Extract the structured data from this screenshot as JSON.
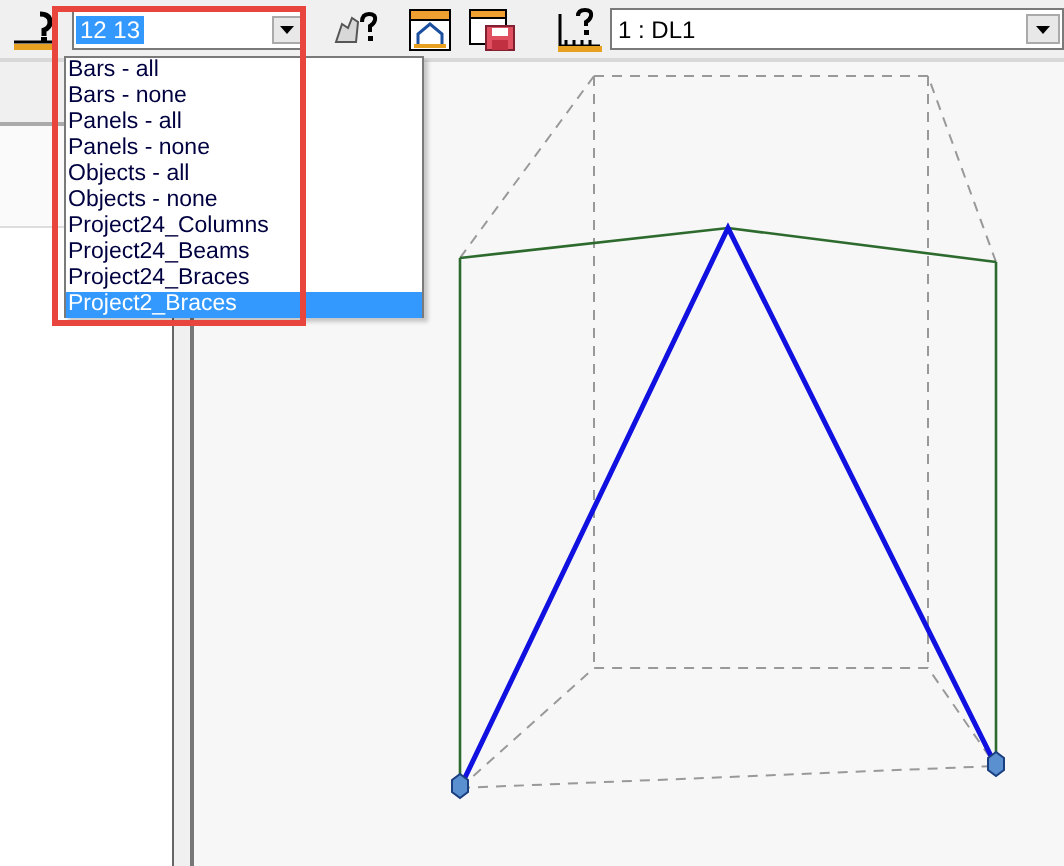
{
  "toolbar": {
    "selection_combo": {
      "value": "12 13"
    },
    "load_case_combo": {
      "value": "1 : DL1"
    }
  },
  "selection_dropdown": {
    "items": [
      {
        "label": "Bars - all",
        "selected": false
      },
      {
        "label": "Bars - none",
        "selected": false
      },
      {
        "label": "Panels - all",
        "selected": false
      },
      {
        "label": "Panels - none",
        "selected": false
      },
      {
        "label": "Objects - all",
        "selected": false
      },
      {
        "label": "Objects - none",
        "selected": false
      },
      {
        "label": "Project24_Columns",
        "selected": false
      },
      {
        "label": "Project24_Beams",
        "selected": false
      },
      {
        "label": "Project24_Braces",
        "selected": false
      },
      {
        "label": "Project2_Braces",
        "selected": true
      }
    ]
  }
}
